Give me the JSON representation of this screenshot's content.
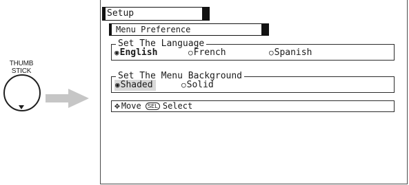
{
  "thumbstick": {
    "label_line1": "THUMB",
    "label_line2": "STICK"
  },
  "menu": {
    "title": "Setup",
    "submenu": "Menu Preference",
    "language_group": {
      "legend": "Set The Language",
      "options": [
        {
          "label": "English",
          "selected": true
        },
        {
          "label": "French",
          "selected": false
        },
        {
          "label": "Spanish",
          "selected": false
        }
      ]
    },
    "background_group": {
      "legend": "Set The Menu Background",
      "options": [
        {
          "label": "Shaded",
          "selected": true
        },
        {
          "label": "Solid",
          "selected": false
        }
      ]
    },
    "status": {
      "move_label": "Move",
      "sel_key": "SEL",
      "select_label": "Select"
    }
  },
  "icons": {
    "radio_selected": "◉",
    "radio_unselected": "○",
    "dpad": "✥"
  },
  "colors": {
    "shaded_highlight": "#d9d9d9",
    "arrow": "#c6c6c6",
    "frame": "#4a4a4a"
  }
}
